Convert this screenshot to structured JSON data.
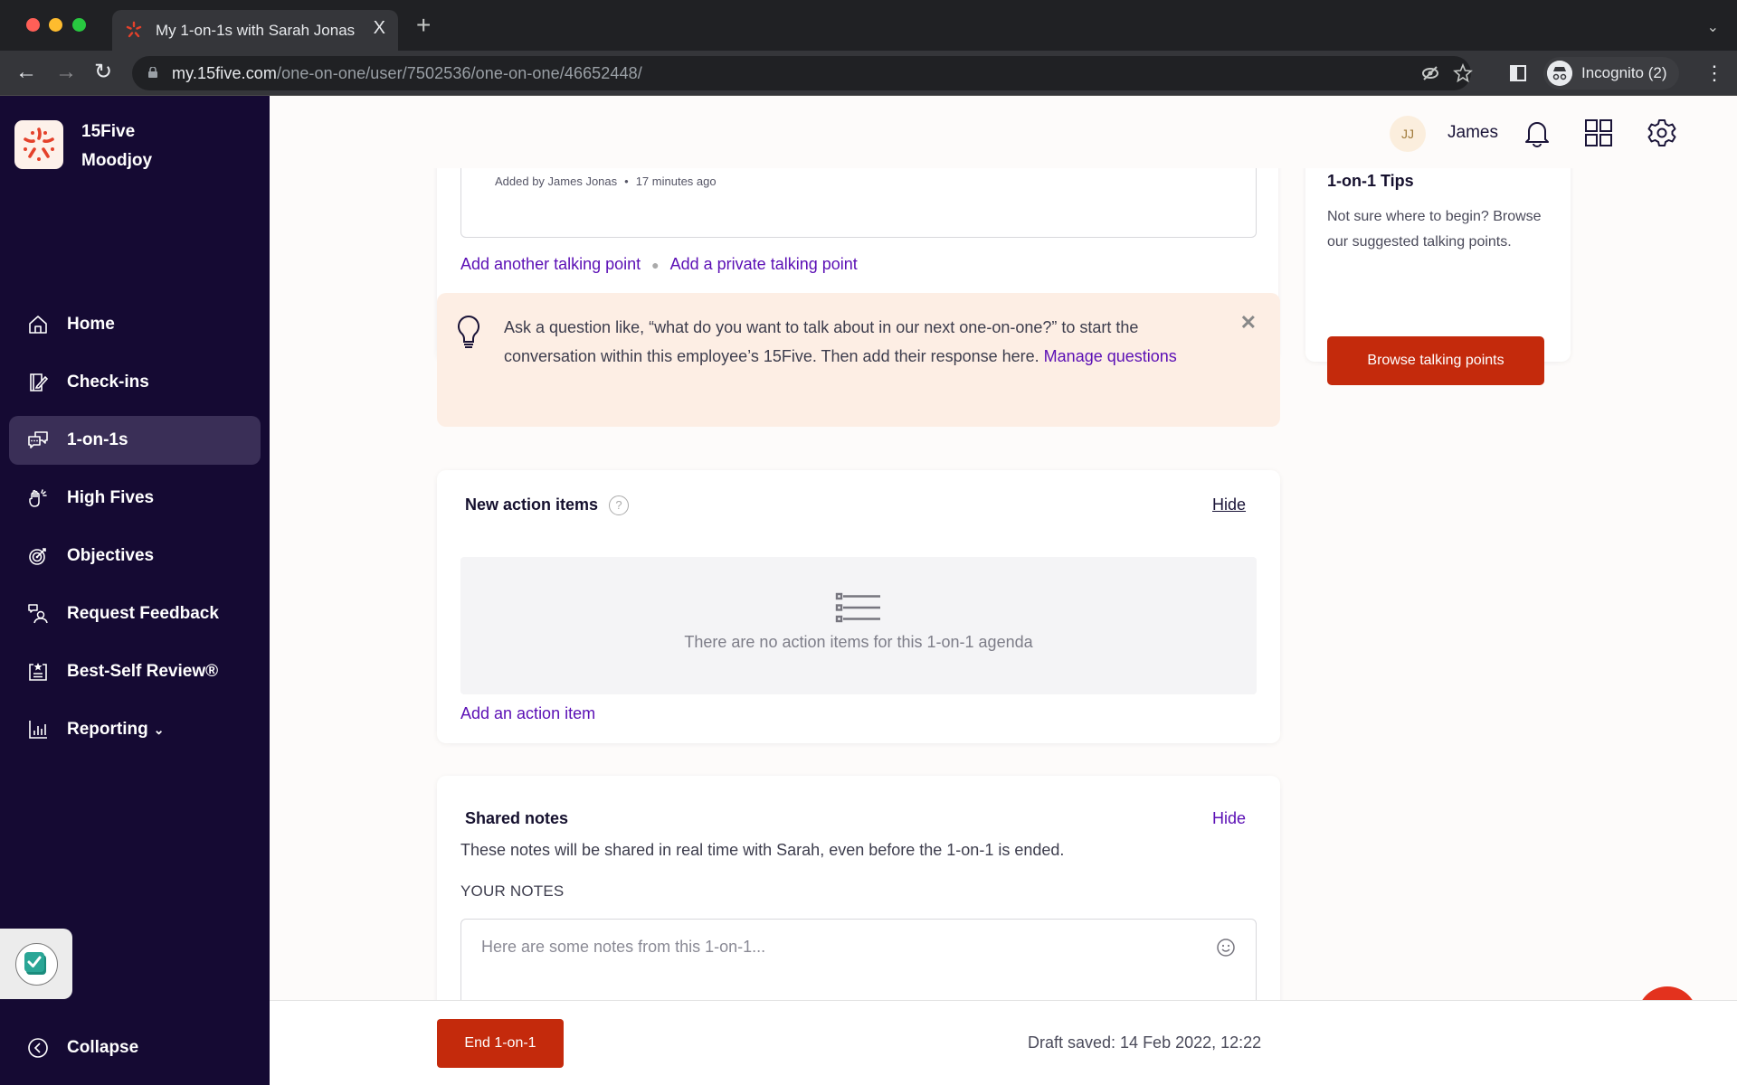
{
  "browser": {
    "tab_title": "My 1-on-1s with Sarah Jonas",
    "tab_close": "X",
    "new_tab": "+",
    "tab_list": "⌄",
    "url_host": "my.15five.com",
    "url_path": "/one-on-one/user/7502536/one-on-one/46652448/",
    "incognito_label": "Incognito (2)",
    "menu": "⋮",
    "back": "←",
    "forward": "→",
    "reload": "↻"
  },
  "sidebar": {
    "org_line1": "15Five",
    "org_line2": "Moodjoy",
    "items": [
      {
        "label": "Home",
        "icon": "home-icon"
      },
      {
        "label": "Check-ins",
        "icon": "check-ins-icon"
      },
      {
        "label": "1-on-1s",
        "icon": "chat-bubbles-icon",
        "active": true
      },
      {
        "label": "High Fives",
        "icon": "high-five-icon"
      },
      {
        "label": "Objectives",
        "icon": "target-icon"
      },
      {
        "label": "Request Feedback",
        "icon": "request-feedback-icon"
      },
      {
        "label": "Best-Self Review®",
        "icon": "review-icon"
      },
      {
        "label": "Reporting",
        "icon": "bar-chart-icon",
        "chevron": "⌄"
      }
    ],
    "collapse_label": "Collapse"
  },
  "header": {
    "avatar_initials": "JJ",
    "user_name": "James"
  },
  "talking_points": {
    "meta_author": "Added by James Jonas",
    "meta_time": "17 minutes ago",
    "add_another": "Add another talking point",
    "add_private": "Add a private talking point"
  },
  "tip_banner": {
    "text": "Ask a question like, “what do you want to talk about in our next one-on-one?” to start the conversation within this employee’s 15Five. Then add their response here. ",
    "link": "Manage questions",
    "close": "✕"
  },
  "action_items": {
    "title": "New action items",
    "help": "?",
    "hide": "Hide",
    "empty_text": "There are no action items for this 1-on-1 agenda",
    "add": "Add an action item"
  },
  "shared_notes": {
    "title": "Shared notes",
    "hide": "Hide",
    "description": "These notes will be shared in real time with Sarah, even before the 1-on-1 is ended.",
    "label": "YOUR NOTES",
    "placeholder": "Here are some notes from this 1-on-1..."
  },
  "tips": {
    "title": "1-on-1 Tips",
    "text": "Not sure where to begin? Browse our suggested talking points.",
    "button": "Browse talking points"
  },
  "footer": {
    "end_button": "End 1-on-1",
    "draft_saved": "Draft saved: 14 Feb 2022, 12:22"
  },
  "colors": {
    "sidebar_bg": "#150a33",
    "accent_link": "#5b0fb5",
    "primary_button": "#c42a0c",
    "banner_bg": "#fdeee4"
  }
}
